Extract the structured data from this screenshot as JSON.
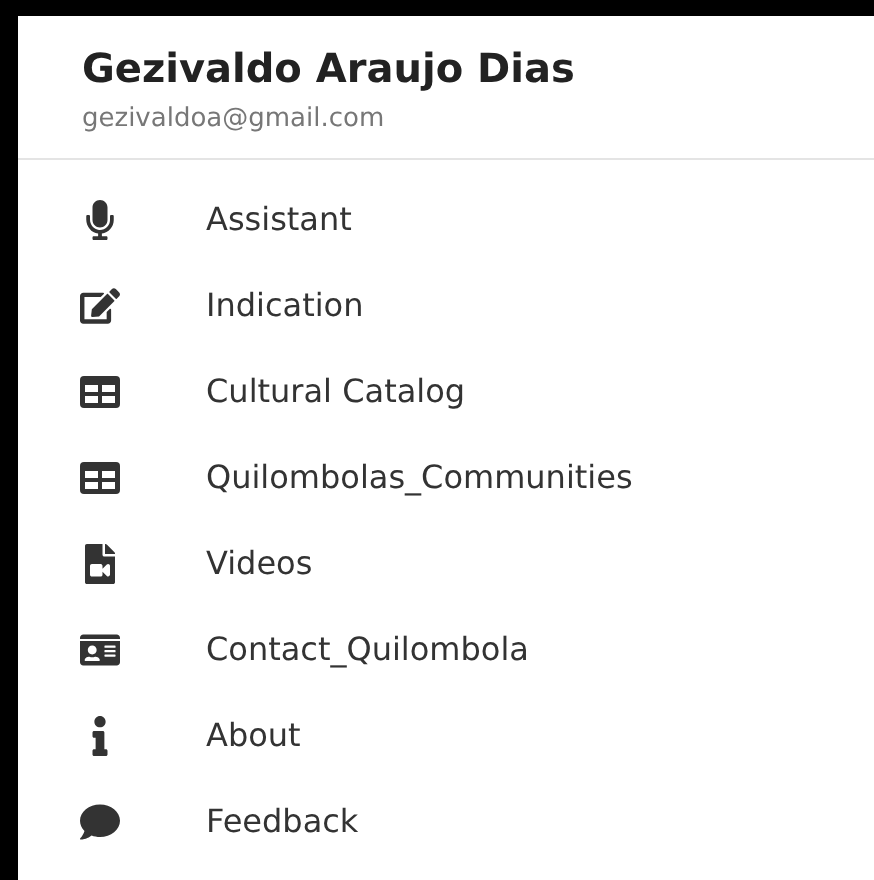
{
  "header": {
    "name": "Gezivaldo Araujo Dias",
    "email": "gezivaldoa@gmail.com"
  },
  "menu": [
    {
      "label": "Assistant",
      "kind": "microphone"
    },
    {
      "label": "Indication",
      "kind": "edit"
    },
    {
      "label": "Cultural Catalog",
      "kind": "grid"
    },
    {
      "label": "Quilombolas_Communities",
      "kind": "grid"
    },
    {
      "label": "Videos",
      "kind": "video"
    },
    {
      "label": "Contact_Quilombola",
      "kind": "contact"
    },
    {
      "label": "About",
      "kind": "info"
    },
    {
      "label": "Feedback",
      "kind": "comment"
    }
  ]
}
